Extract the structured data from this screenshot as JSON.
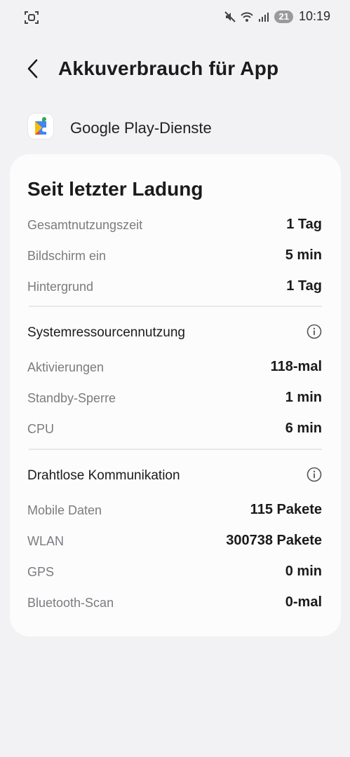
{
  "status_bar": {
    "battery": "21",
    "time": "10:19",
    "icons": [
      "screenshot-icon",
      "mute-icon",
      "wifi-icon",
      "signal-icon"
    ]
  },
  "header": {
    "title": "Akkuverbrauch für App",
    "back_icon": "chevron-left-icon"
  },
  "app": {
    "name": "Google Play-Dienste",
    "icon": "google-play-services-icon"
  },
  "card": {
    "title": "Seit letzter Ladung",
    "usage": [
      {
        "label": "Gesamtnutzungszeit",
        "value": "1 Tag"
      },
      {
        "label": "Bildschirm ein",
        "value": "5 min"
      },
      {
        "label": "Hintergrund",
        "value": "1 Tag"
      }
    ],
    "system": {
      "heading": "Systemressourcennutzung",
      "rows": [
        {
          "label": "Aktivierungen",
          "value": "118-mal"
        },
        {
          "label": "Standby-Sperre",
          "value": "1 min"
        },
        {
          "label": "CPU",
          "value": "6 min"
        }
      ]
    },
    "wireless": {
      "heading": "Drahtlose Kommunikation",
      "rows": [
        {
          "label": "Mobile Daten",
          "value": "115 Pakete"
        },
        {
          "label": "WLAN",
          "value": "300738 Pakete"
        },
        {
          "label": "GPS",
          "value": "0 min"
        },
        {
          "label": "Bluetooth-Scan",
          "value": "0-mal"
        }
      ]
    }
  }
}
